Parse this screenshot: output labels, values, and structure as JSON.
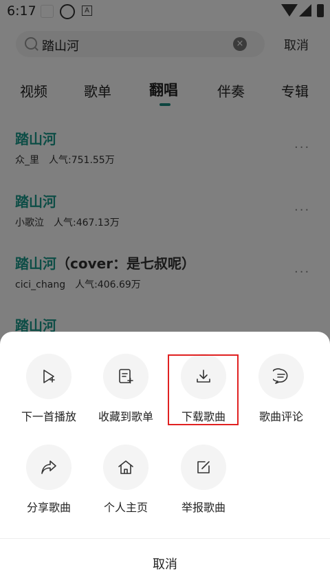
{
  "status_bar": {
    "time": "6:17",
    "badge_letter": "A"
  },
  "search": {
    "query": "踏山河",
    "clear_glyph": "×",
    "cancel_label": "取消"
  },
  "tabs": [
    {
      "label": "视频",
      "active": false
    },
    {
      "label": "歌单",
      "active": false
    },
    {
      "label": "翻唱",
      "active": true
    },
    {
      "label": "伴奏",
      "active": false
    },
    {
      "label": "专辑",
      "active": false
    }
  ],
  "results": [
    {
      "title": "踏山河",
      "title_suffix": "",
      "artist": "众_里",
      "popularity": "人气:751.55万"
    },
    {
      "title": "踏山河",
      "title_suffix": "",
      "artist": "小歌泣",
      "popularity": "人气:467.13万"
    },
    {
      "title": "踏山河",
      "title_suffix": "（cover：是七叔呢）",
      "artist": "cici_chang",
      "popularity": "人气:406.69万"
    },
    {
      "title": "踏山河",
      "title_suffix": "",
      "artist": "",
      "popularity": ""
    }
  ],
  "more_glyph": "···",
  "sheet": {
    "actions": [
      {
        "label": "下一首播放",
        "icon": "play-next-icon"
      },
      {
        "label": "收藏到歌单",
        "icon": "add-to-playlist-icon"
      },
      {
        "label": "下载歌曲",
        "icon": "download-icon"
      },
      {
        "label": "歌曲评论",
        "icon": "comment-icon"
      },
      {
        "label": "分享歌曲",
        "icon": "share-icon"
      },
      {
        "label": "个人主页",
        "icon": "home-icon"
      },
      {
        "label": "举报歌曲",
        "icon": "report-icon"
      }
    ],
    "cancel_label": "取消"
  },
  "colors": {
    "accent": "#1a9a8c",
    "highlight_border": "#e02020",
    "overlay": "rgba(0,0,0,0.5)"
  }
}
